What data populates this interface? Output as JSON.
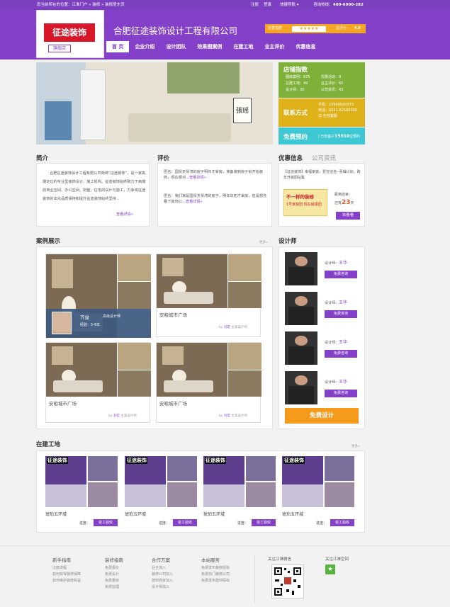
{
  "topbar": {
    "location": "您当前所在的位置：江淮门户 » 装修 » 装修房东页",
    "login": "注册",
    "register": "登录",
    "quicknav": "快捷导航",
    "hotline_label": "咨询热线：",
    "hotline": "400-6900-282"
  },
  "brand": {
    "logo_text": "征途装饰",
    "flagship": "旗舰店",
    "company": "合肥征途装饰设计工程有限公司"
  },
  "rating": {
    "label": "信誉指数",
    "total_label": "总评分：",
    "total": "4.8"
  },
  "nav": [
    "首 页",
    "企业介绍",
    "设计团队",
    "效果图案例",
    "在建工地",
    "业主评价",
    "优惠信息"
  ],
  "stats": {
    "title": "店铺指数",
    "items": [
      "图库案例：675",
      "在建工地：49",
      "设计师：30",
      "优惠活动：9",
      "业主评价：65",
      "公司资讯：43"
    ]
  },
  "contact": {
    "title": "联系方式",
    "phone_label": "手机：",
    "phone": "15950920573",
    "tel_label": "电话：",
    "tel": "0551-62595560",
    "qq": "在线客服"
  },
  "free": {
    "title": "免费预约",
    "text_prefix": "| 已有客户",
    "count": "15910",
    "text_suffix": "位预约"
  },
  "intro": {
    "title": "简介",
    "text": "合肥征途装饰设计工程有限公司简称“征途装饰”，是一家高端定位的专业型装饰设计、施工机构。征途装饰始终致力于高端的商业空间、办公空间、别墅、住宅的设计与施工，力争将征途装饰的出众品质保持和提升征途装饰始终坚持...",
    "more": "查看详情»"
  },
  "reviews": {
    "title": "评价",
    "items": [
      {
        "text": "匿名：国贸天琴湾的房子明年才拿房，准备装到房子就开始装修，现在想对...",
        "more": "查看详情»"
      },
      {
        "text": "匿名：我们家是国贸天琴湾的房子，明年年初才拿房，但是想先看下装饰公...",
        "more": "查看详情»"
      }
    ]
  },
  "promo": {
    "tab1": "优惠信息",
    "tab2": "公司资讯",
    "headline": "【征途装饰】幸福家装，爱在征途--喜铺计划，跨年开装团征集",
    "poster_line1": "不一样的装修",
    "poster_line2": "1号家装团 现在就报团",
    "remaining_label": "距离结束：",
    "remaining_prefix": "还有",
    "remaining_days": "23",
    "remaining_unit": "天",
    "button": "去看看"
  },
  "cases": {
    "title": "案例展示",
    "more": "更多»",
    "items": [
      {
        "title": "",
        "designer_name": "齐益",
        "designer_rank": "高级设计师",
        "experience": "经验：5-8年",
        "by": "",
        "role": ""
      },
      {
        "title": "安粮城市广场",
        "designer_name": "",
        "designer_rank": "",
        "experience": "",
        "by": "by",
        "author": "刘宏",
        "role": "主案设计师"
      },
      {
        "title": "安粮城市广场",
        "designer_name": "",
        "designer_rank": "",
        "experience": "",
        "by": "by",
        "author": "刘宏",
        "role": "主案设计师"
      },
      {
        "title": "安粮城市广场",
        "designer_name": "",
        "designer_rank": "",
        "experience": "",
        "by": "by",
        "author": "刘宏",
        "role": "主案设计师"
      }
    ]
  },
  "designers": {
    "title": "设计师",
    "items": [
      {
        "label": "设计师：",
        "name": "王华",
        "button": "免费咨询"
      },
      {
        "label": "设计师：",
        "name": "王华",
        "button": "免费咨询"
      },
      {
        "label": "设计师：",
        "name": "王华",
        "button": "免费咨询"
      },
      {
        "label": "设计师：",
        "name": "王华",
        "button": "免费咨询"
      }
    ],
    "cta": "免费设计"
  },
  "sites": {
    "title": "在建工地",
    "more": "更多»",
    "items": [
      {
        "name": "琥珀五环城",
        "progress_label": "进度：",
        "button": "竣工验收"
      },
      {
        "name": "琥珀五环城",
        "progress_label": "进度：",
        "button": "竣工验收"
      },
      {
        "name": "琥珀五环城",
        "progress_label": "进度：",
        "button": "竣工验收"
      },
      {
        "name": "琥珀五环城",
        "progress_label": "进度：",
        "button": "竣工验收"
      }
    ]
  },
  "footer": {
    "cols": [
      {
        "title": "新手指南",
        "links": [
          "注册流程",
          "如何获得装修保障",
          "如何维护装修权益"
        ]
      },
      {
        "title": "装修指南",
        "links": [
          "免费报价",
          "免费设计",
          "免费量房",
          "免费监理"
        ]
      },
      {
        "title": "合作方案",
        "links": [
          "业主加入",
          "装修公司加入",
          "建材商家加入",
          "设计师加入"
        ]
      },
      {
        "title": "本站服务",
        "links": [
          "免费发布装修招标",
          "免费找门装修公司",
          "免费发布建材招标"
        ]
      }
    ],
    "wechat": "关注江淮微信",
    "qzone": "关注江淮空间"
  },
  "colors": {
    "purple": "#8540c9",
    "green": "#7fb13a",
    "yellow": "#e0b21a",
    "cyan": "#3ec8d3",
    "orange": "#f59a1b"
  }
}
